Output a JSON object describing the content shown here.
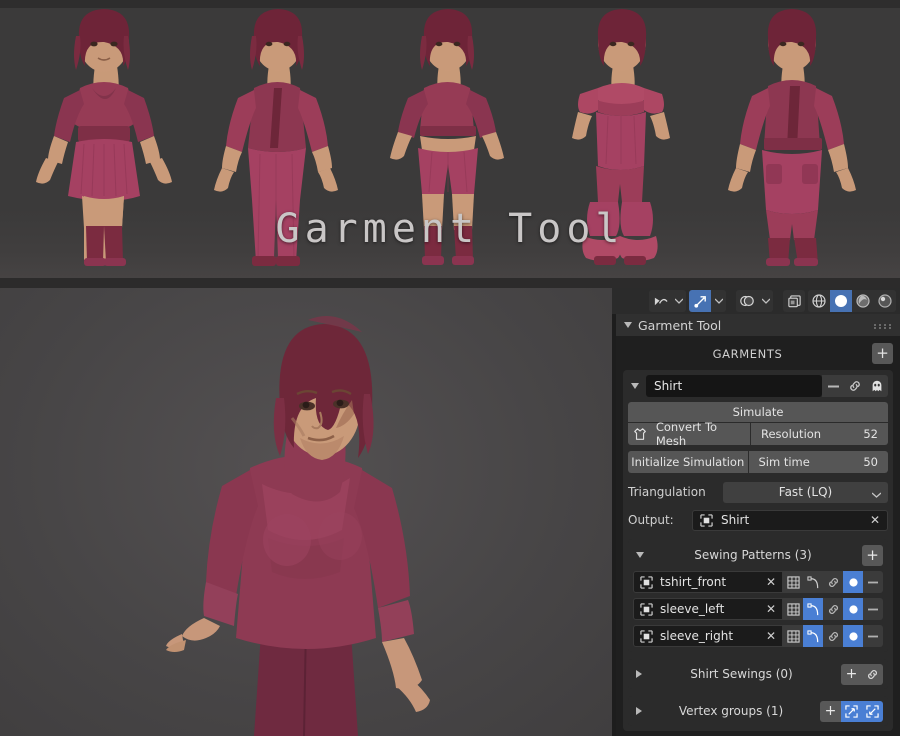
{
  "banner": {
    "title": "Garment Tool",
    "figures": [
      {
        "name": "belted-dress-with-boots"
      },
      {
        "name": "jacket-and-trousers"
      },
      {
        "name": "crop-top-and-shorts"
      },
      {
        "name": "ruffle-top-and-flared-pants"
      },
      {
        "name": "long-coat-and-boots"
      }
    ]
  },
  "viewport": {
    "model_name": "hooded-shirt-character",
    "toolbar": [
      {
        "name": "proportional-editing-falloff",
        "icon": "falloff-curve-icon",
        "active": false,
        "has_caret": true
      },
      {
        "name": "snap-magnet",
        "icon": "snap-icon",
        "active": true,
        "has_caret": true
      },
      {
        "name": "overlays-toggle",
        "icon": "overlays-icon",
        "active": false,
        "has_caret": true
      },
      {
        "name": "xray-toggle",
        "icon": "xray-icon",
        "active": false,
        "has_caret": false
      },
      {
        "name": "shading-wireframe",
        "icon": "wireframe-sphere-icon",
        "active": false,
        "has_caret": false
      },
      {
        "name": "shading-solid",
        "icon": "solid-sphere-icon",
        "active": true,
        "has_caret": false
      },
      {
        "name": "shading-material-preview",
        "icon": "material-sphere-icon",
        "active": false,
        "has_caret": false
      },
      {
        "name": "shading-rendered",
        "icon": "rendered-sphere-icon",
        "active": false,
        "has_caret": false
      }
    ]
  },
  "panel": {
    "title": "Garment Tool",
    "garments_header": {
      "label": "GARMENTS",
      "add_label": "+"
    },
    "garment": {
      "name": "Shirt",
      "header_buttons": [
        {
          "name": "remove-garment-button",
          "icon": "minus-icon",
          "label": "–"
        },
        {
          "name": "link-garment-button",
          "icon": "link-icon"
        },
        {
          "name": "ghost-visibility-button",
          "icon": "ghost-icon"
        }
      ],
      "simulate_label": "Simulate",
      "convert_label": "Convert To Mesh",
      "resolution_label": "Resolution",
      "resolution_value": "52",
      "initialize_label": "Initialize Simulation",
      "simtime_label": "Sim time",
      "simtime_value": "50",
      "triangulation_label": "Triangulation",
      "triangulation_value": "Fast (LQ)",
      "output_label": "Output:",
      "output_value": "Shirt",
      "output_clear": "✕"
    },
    "sewing_patterns": {
      "header": "Sewing Patterns (3)",
      "add_label": "+",
      "rows": [
        {
          "name": "tshirt_front",
          "clear": "✕",
          "grid_on": false,
          "curve_on": false,
          "link_on": false,
          "dot_on": true
        },
        {
          "name": "sleeve_left",
          "clear": "✕",
          "grid_on": false,
          "curve_on": true,
          "link_on": false,
          "dot_on": true
        },
        {
          "name": "sleeve_right",
          "clear": "✕",
          "grid_on": false,
          "curve_on": true,
          "link_on": false,
          "dot_on": true
        }
      ]
    },
    "shirt_sewings": {
      "label": "Shirt Sewings (0)",
      "add_label": "+",
      "buttons": [
        {
          "name": "add-sewing-button",
          "icon": "plus-icon",
          "active": false
        },
        {
          "name": "link-sewing-button",
          "icon": "link-icon",
          "active": false
        }
      ]
    },
    "vertex_groups": {
      "label": "Vertex groups (1)",
      "add_label": "+",
      "buttons": [
        {
          "name": "add-vertex-group-button",
          "icon": "plus-icon",
          "active": false
        },
        {
          "name": "expand-selection-button",
          "icon": "expand-arrows-icon",
          "active": true
        },
        {
          "name": "shrink-selection-button",
          "icon": "shrink-arrows-icon",
          "active": true
        }
      ]
    }
  },
  "colors": {
    "accent_blue": "#4a7fd4",
    "panel_bg": "#1f1f1f",
    "card_bg": "#2b2b2b",
    "button_gray": "#565656",
    "garment_maroon": "#7d3248",
    "skin": "#c99a79"
  }
}
